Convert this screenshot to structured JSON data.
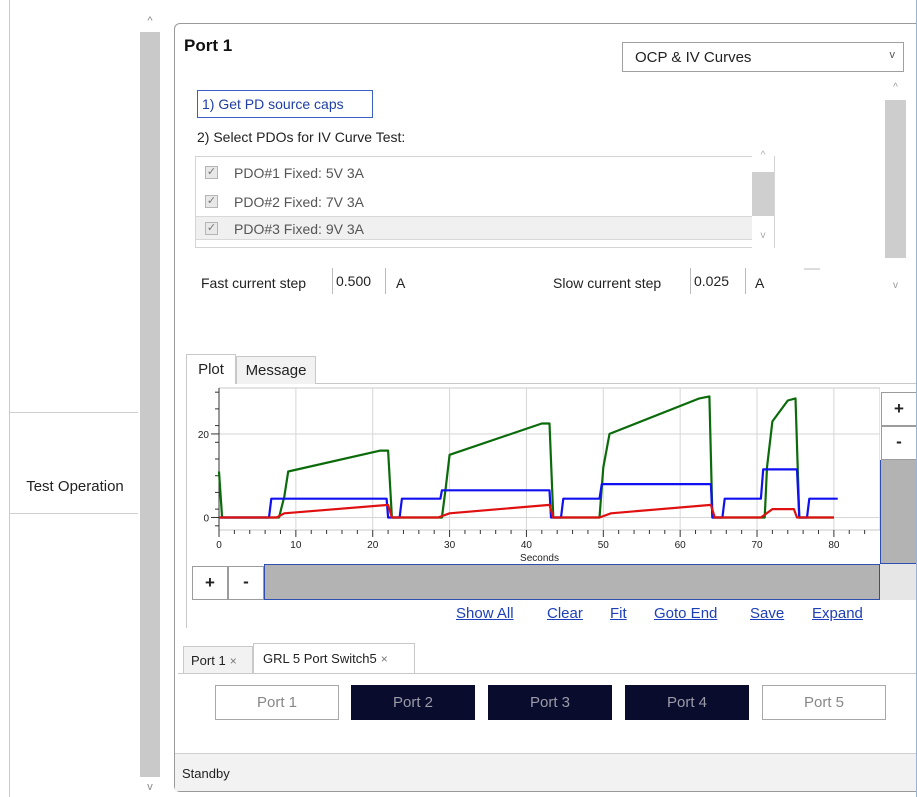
{
  "sidebar": {
    "nav_item_label": "Test Operation",
    "scroll_up_glyph": "^",
    "scroll_down_glyph": "v"
  },
  "panel": {
    "title": "Port 1",
    "mode_select": {
      "value": "OCP & IV Curves",
      "chevron": "v"
    },
    "get_caps_label": "1) Get PD source caps",
    "select_pdos_label": "2) Select PDOs for IV Curve Test:",
    "pdos": [
      {
        "label": "PDO#1 Fixed: 5V 3A",
        "checked": true
      },
      {
        "label": "PDO#2 Fixed: 7V 3A",
        "checked": true
      },
      {
        "label": "PDO#3 Fixed: 9V 3A",
        "checked": true,
        "selected": true
      }
    ],
    "fast_step": {
      "label": "Fast current step",
      "value": "0.500",
      "unit": "A"
    },
    "slow_step": {
      "label": "Slow current step",
      "value": "0.025",
      "unit": "A"
    }
  },
  "tabs": [
    "Plot",
    "Message"
  ],
  "zoom": {
    "plus": "+",
    "minus": "-"
  },
  "plot_links": [
    "Show All",
    "Clear",
    "Fit",
    "Goto End",
    "Save",
    "Expand"
  ],
  "doc_tabs": [
    {
      "label": "Port 1",
      "close": "×"
    },
    {
      "label": "GRL 5 Port Switch5",
      "close": "×"
    }
  ],
  "port_buttons": [
    {
      "label": "Port 1",
      "state": "inactive"
    },
    {
      "label": "Port 2",
      "state": "active"
    },
    {
      "label": "Port 3",
      "state": "active"
    },
    {
      "label": "Port 4",
      "state": "active"
    },
    {
      "label": "Port 5",
      "state": "inactive"
    }
  ],
  "status": "Standby",
  "colors": {
    "series_green": "#0b6b0b",
    "series_blue": "#1010f0",
    "series_red": "#e01010",
    "link_blue": "#1d3fb8",
    "active_port_bg": "#0a0c2e"
  },
  "chart_data": {
    "type": "line",
    "xlabel": "Seconds",
    "ylabel": "",
    "xlim": [
      0,
      86
    ],
    "ylim": [
      -3,
      31
    ],
    "x_ticks": [
      0,
      10,
      20,
      30,
      40,
      50,
      60,
      70,
      80
    ],
    "y_ticks": [
      0,
      20
    ],
    "grid": true,
    "series": [
      {
        "color": "#0b6b0b",
        "points": [
          [
            0,
            11
          ],
          [
            0.4,
            0
          ],
          [
            7.8,
            0
          ],
          [
            8.5,
            5
          ],
          [
            9,
            11
          ],
          [
            21,
            16
          ],
          [
            22,
            16
          ],
          [
            22.5,
            0
          ],
          [
            29,
            0
          ],
          [
            29.5,
            7
          ],
          [
            30,
            15
          ],
          [
            42,
            22.5
          ],
          [
            43,
            22.5
          ],
          [
            43.5,
            0
          ],
          [
            49.5,
            0
          ],
          [
            50,
            12
          ],
          [
            50.8,
            20
          ],
          [
            62.5,
            28.5
          ],
          [
            63.8,
            29
          ],
          [
            64.2,
            0
          ],
          [
            71,
            0
          ],
          [
            71.3,
            12
          ],
          [
            72,
            23
          ],
          [
            74,
            28
          ],
          [
            75,
            28.5
          ],
          [
            75.5,
            0
          ],
          [
            80,
            0
          ]
        ]
      },
      {
        "color": "#1010f0",
        "points": [
          [
            0,
            0
          ],
          [
            6.5,
            0
          ],
          [
            6.8,
            4.5
          ],
          [
            21.8,
            4.5
          ],
          [
            22,
            0
          ],
          [
            23.5,
            0
          ],
          [
            23.8,
            4.5
          ],
          [
            28.8,
            4.5
          ],
          [
            29,
            6.5
          ],
          [
            43,
            6.5
          ],
          [
            43.2,
            0
          ],
          [
            44.5,
            0
          ],
          [
            44.8,
            4.5
          ],
          [
            49.5,
            4.5
          ],
          [
            49.8,
            8
          ],
          [
            64,
            8
          ],
          [
            64.2,
            0
          ],
          [
            65.5,
            0
          ],
          [
            65.8,
            4.5
          ],
          [
            70.5,
            4.5
          ],
          [
            70.8,
            11.5
          ],
          [
            75.2,
            11.5
          ],
          [
            75.5,
            0
          ],
          [
            76.5,
            0
          ],
          [
            76.8,
            4.5
          ],
          [
            80.5,
            4.5
          ]
        ]
      },
      {
        "color": "#e01010",
        "points": [
          [
            0,
            0
          ],
          [
            7.5,
            0
          ],
          [
            8.5,
            1
          ],
          [
            22,
            3
          ],
          [
            22.5,
            0
          ],
          [
            28.5,
            0
          ],
          [
            30,
            1
          ],
          [
            43,
            3
          ],
          [
            43.5,
            0
          ],
          [
            49.5,
            0
          ],
          [
            51,
            1
          ],
          [
            64,
            3
          ],
          [
            64.5,
            0
          ],
          [
            70.5,
            0
          ],
          [
            72,
            2
          ],
          [
            74.8,
            2
          ],
          [
            75.2,
            0
          ],
          [
            80,
            0
          ]
        ]
      }
    ]
  }
}
